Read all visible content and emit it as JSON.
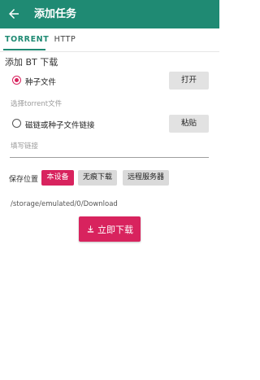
{
  "appbar": {
    "title": "添加任务"
  },
  "tabs": [
    {
      "label": "TORRENT"
    },
    {
      "label": "HTTP"
    }
  ],
  "section": {
    "title": "添加 BT 下载"
  },
  "torrent_option": {
    "label": "种子文件",
    "button": "打开",
    "placeholder": "选择torrent文件",
    "checked": true
  },
  "magnet_option": {
    "label": "磁链或种子文件链接",
    "button": "粘贴",
    "placeholder": "填写链接",
    "checked": false
  },
  "save_location": {
    "label": "保存位置",
    "options": [
      "本设备",
      "无痕下载",
      "远程服务器"
    ],
    "selected": "本设备",
    "path": "/storage/emulated/0/Download"
  },
  "download_button": {
    "label": "立即下载"
  },
  "colors": {
    "primary": "#1f8a73",
    "accent": "#d8235e"
  },
  "icons": {
    "back": "arrow-back-icon",
    "download": "download-icon"
  }
}
